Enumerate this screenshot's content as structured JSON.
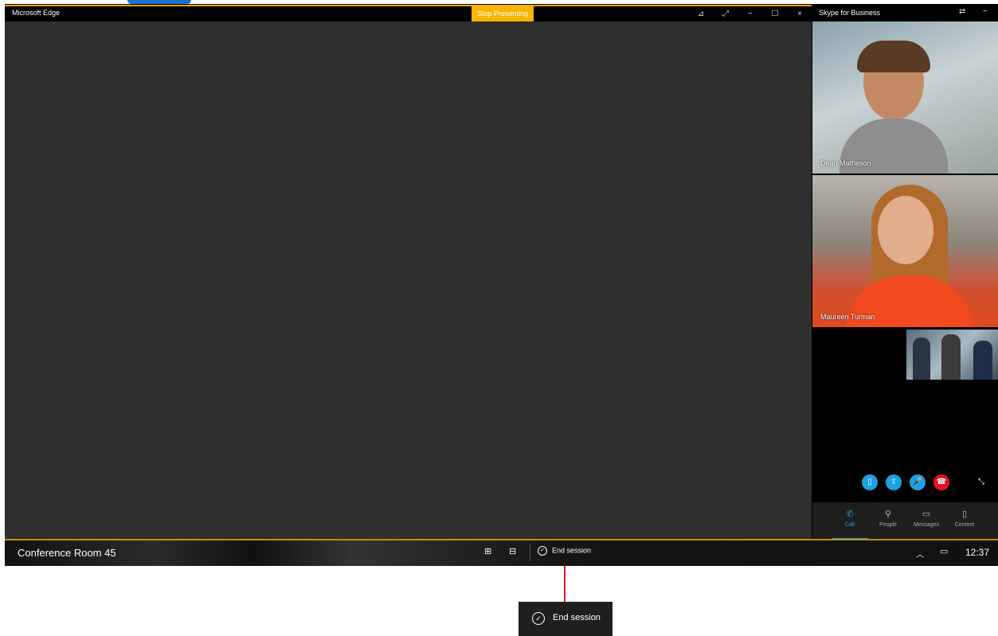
{
  "edge": {
    "title": "Microsoft Edge",
    "stop_presenting": "Stop Presenting",
    "controls": {
      "pin": "⊿",
      "expand": "⤢",
      "minimize": "−",
      "maximize": "☐",
      "close": "×"
    }
  },
  "skype": {
    "title": "Skype for Business",
    "controls": {
      "swap": "⇄",
      "minimize": "−"
    },
    "participants": [
      {
        "name": "Dean Matheson"
      },
      {
        "name": "Maureen Turman"
      }
    ],
    "call_controls": {
      "video": "▯",
      "share": "⇪",
      "mic": "🎤",
      "hangup": "☎"
    },
    "popout": "⤡",
    "tabs": [
      {
        "label": "Call",
        "icon": "✆",
        "active": true
      },
      {
        "label": "People",
        "icon": "⚲",
        "active": false
      },
      {
        "label": "Messages",
        "icon": "▭",
        "active": false
      },
      {
        "label": "Content",
        "icon": "▯",
        "active": false
      }
    ],
    "accent": "#1ba1e2",
    "hangup_color": "#e81123"
  },
  "taskbar": {
    "room_name": "Conference Room 45",
    "start_icon": "⊞",
    "task_view_icon": "⊟",
    "end_session": "End session",
    "end_session_icon": "✓",
    "tray_chevron": "︿",
    "notifications_icon": "▭",
    "clock": "12:37"
  },
  "callout": {
    "label": "End session",
    "icon": "✓"
  },
  "colors": {
    "present_bar": "#f7b500",
    "callout_line": "#e81123"
  }
}
